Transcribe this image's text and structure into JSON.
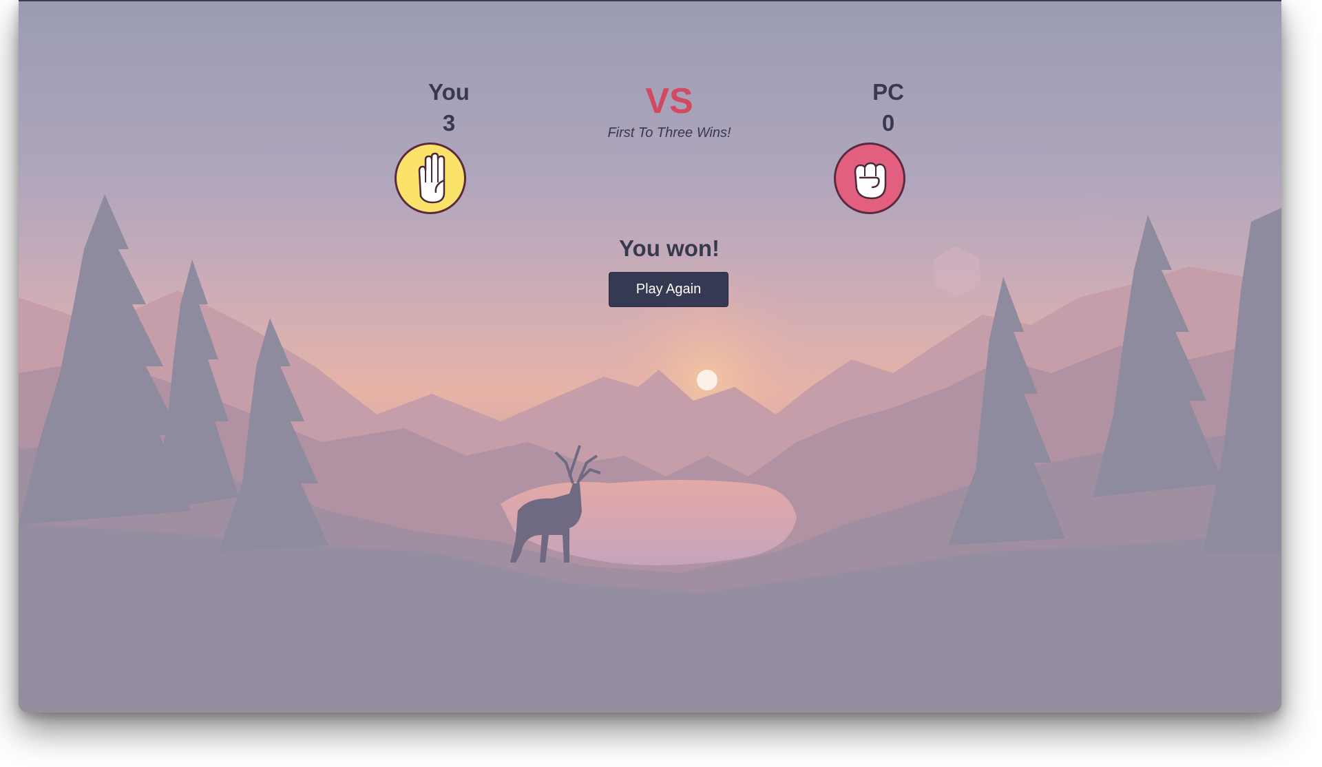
{
  "game": {
    "player": {
      "name": "You",
      "score": "3",
      "choice_icon": "hand-paper-icon"
    },
    "computer": {
      "name": "PC",
      "score": "0",
      "choice_icon": "hand-rock-icon"
    },
    "vs_label": "VS",
    "subtitle": "First To Three Wins!",
    "result": "You won!",
    "play_again_label": "Play Again"
  },
  "colors": {
    "accent": "#d24a62",
    "text": "#37394f",
    "button_bg": "#353a52",
    "player_choice_bg": "#fbe26a",
    "computer_choice_bg": "#e35f7f"
  }
}
